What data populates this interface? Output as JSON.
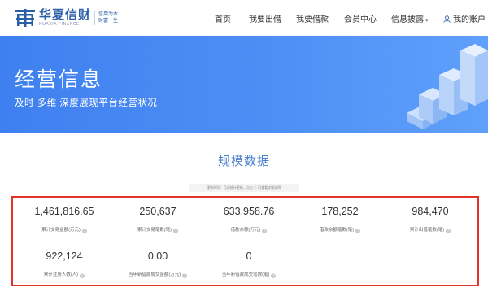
{
  "header": {
    "logo": {
      "name_cn": "华夏信财",
      "name_en": "HUAXIA FINANCE",
      "slogan_line1": "信用为本",
      "slogan_line2": "财富一生"
    },
    "nav": [
      {
        "label": "首页"
      },
      {
        "label": "我要出借"
      },
      {
        "label": "我要借款"
      },
      {
        "label": "会员中心"
      },
      {
        "label": "信息披露"
      },
      {
        "label": "我的账户"
      }
    ]
  },
  "banner": {
    "title": "经营信息",
    "subtitle": "及时 多维 深度展现平台经营状况"
  },
  "section": {
    "title": "规模数据",
    "notice": "更新时间：月初统计更新，点击 ⓘ 可查看详细说明"
  },
  "stats": [
    {
      "value": "1,461,816.65",
      "label": "累计交易金额(万元)"
    },
    {
      "value": "250,637",
      "label": "累计交易笔数(笔)"
    },
    {
      "value": "633,958.76",
      "label": "借款余额(万元)"
    },
    {
      "value": "178,252",
      "label": "借款余额笔数(笔)"
    },
    {
      "value": "984,470",
      "label": "累计出借笔数(笔)"
    },
    {
      "value": "922,124",
      "label": "累计注册人数(人)"
    },
    {
      "value": "0.00",
      "label": "当年新借款成交金额(万元)"
    },
    {
      "value": "0",
      "label": "当年新借款成交笔数(笔)"
    }
  ],
  "colors": {
    "brand": "#2a5fa8",
    "banner": "#4d8ef5",
    "section_title": "#4a7fcf",
    "highlight_border": "#e2332b"
  }
}
